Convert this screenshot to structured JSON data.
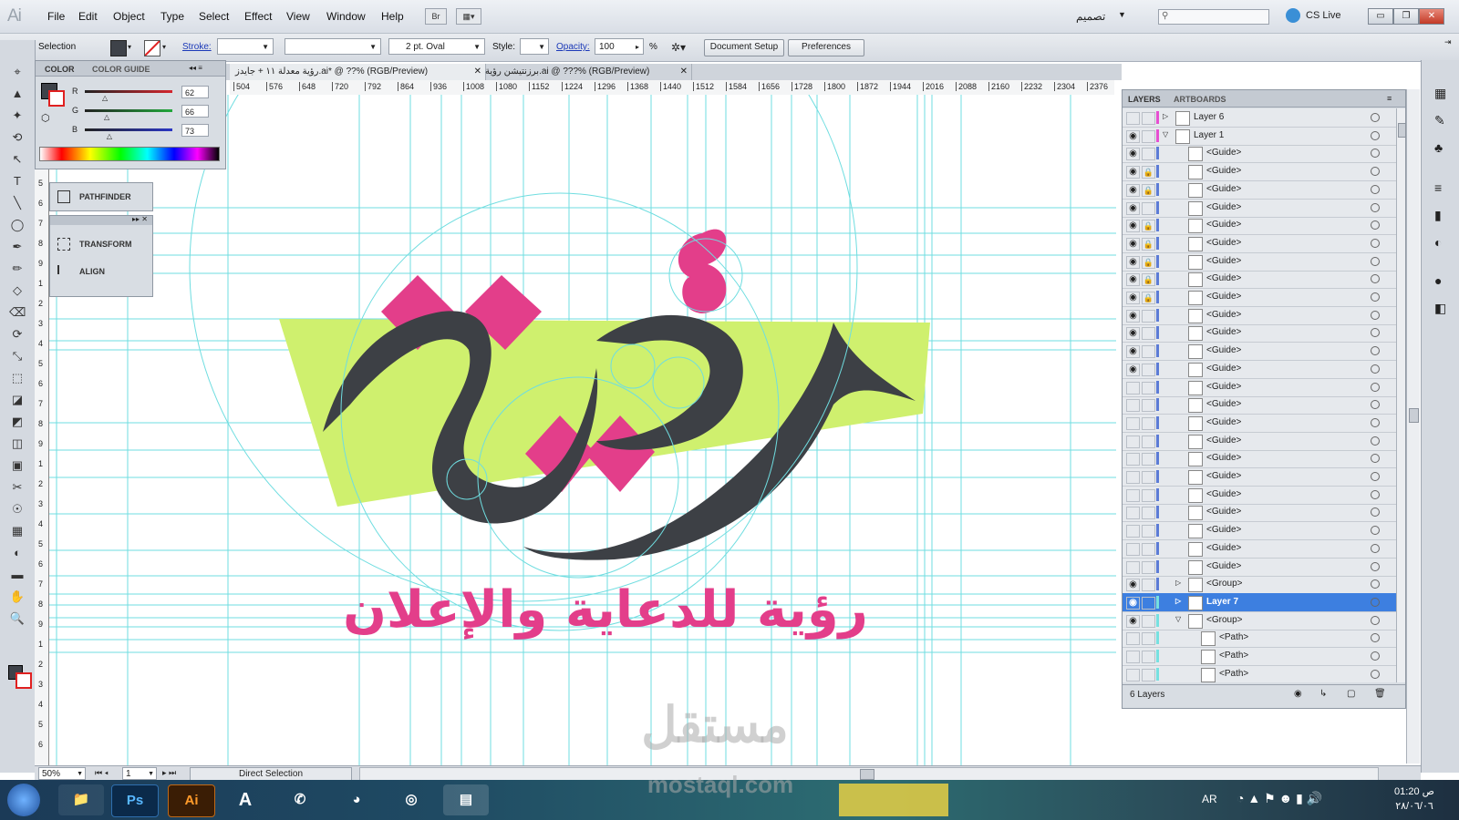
{
  "app": {
    "logo": "Ai"
  },
  "menu": [
    "File",
    "Edit",
    "Object",
    "Type",
    "Select",
    "Effect",
    "View",
    "Window",
    "Help"
  ],
  "menubar_right": {
    "bridge": "Br",
    "workspace": "تصميم",
    "cs_live": "CS Live"
  },
  "control": {
    "selection": "Selection",
    "stroke_label": "Stroke:",
    "brush": "2 pt. Oval",
    "style_label": "Style:",
    "opacity_label": "Opacity:",
    "opacity_value": "100",
    "opacity_unit": "%",
    "document_setup": "Document Setup",
    "preferences": "Preferences"
  },
  "tabs": [
    {
      "label": "رؤية معدلة ١١ + جايدز.ai* @ ??% (RGB/Preview)",
      "active": true
    },
    {
      "label": "برزنتيشن رؤية.ai @ ???% (RGB/Preview)",
      "active": false
    }
  ],
  "ruler_ticks": [
    "504",
    "576",
    "648",
    "720",
    "792",
    "864",
    "936",
    "1008",
    "1080",
    "1152",
    "1224",
    "1296",
    "1368",
    "1440",
    "1512",
    "1584",
    "1656",
    "1728",
    "1800",
    "1872",
    "1944",
    "2016",
    "2088",
    "2160",
    "2232",
    "2304",
    "2376"
  ],
  "vruler_ticks": [
    "1",
    "2",
    "3",
    "4",
    "5",
    "6",
    "7",
    "8",
    "9",
    "1",
    "2",
    "3",
    "4",
    "5",
    "6",
    "7",
    "8",
    "9",
    "1",
    "2",
    "3",
    "4",
    "5",
    "6",
    "7",
    "8",
    "9",
    "1",
    "2",
    "3",
    "4",
    "5",
    "6"
  ],
  "color_panel": {
    "tab_color": "COLOR",
    "tab_guide": "COLOR GUIDE",
    "channels": [
      {
        "label": "R",
        "value": "62",
        "level": 0.24,
        "color": "#d4262e"
      },
      {
        "label": "G",
        "value": "66",
        "level": 0.26,
        "color": "#22a83c"
      },
      {
        "label": "B",
        "value": "73",
        "level": 0.29,
        "color": "#2b36c4"
      }
    ],
    "fill_color": "#3e4249"
  },
  "side_panels": {
    "pathfinder": "PATHFINDER",
    "transform": "TRANSFORM",
    "align": "ALIGN"
  },
  "layers_panel": {
    "tab_layers": "LAYERS",
    "tab_artboards": "ARTBOARDS",
    "count": "6 Layers",
    "rows": [
      {
        "name": "Layer 6",
        "indent": 0,
        "eye": false,
        "lock": false,
        "expand": "right",
        "bar": "#e64fd1",
        "selected": false
      },
      {
        "name": "Layer 1",
        "indent": 0,
        "eye": true,
        "lock": false,
        "expand": "down",
        "bar": "#e64fd1",
        "selected": false
      },
      {
        "name": "<Guide>",
        "indent": 1,
        "eye": true,
        "lock": false,
        "bar": "#5b7bd6"
      },
      {
        "name": "<Guide>",
        "indent": 1,
        "eye": true,
        "lock": true,
        "bar": "#5b7bd6"
      },
      {
        "name": "<Guide>",
        "indent": 1,
        "eye": true,
        "lock": true,
        "bar": "#5b7bd6"
      },
      {
        "name": "<Guide>",
        "indent": 1,
        "eye": true,
        "lock": false,
        "bar": "#5b7bd6"
      },
      {
        "name": "<Guide>",
        "indent": 1,
        "eye": true,
        "lock": true,
        "bar": "#5b7bd6"
      },
      {
        "name": "<Guide>",
        "indent": 1,
        "eye": true,
        "lock": true,
        "bar": "#5b7bd6"
      },
      {
        "name": "<Guide>",
        "indent": 1,
        "eye": true,
        "lock": true,
        "bar": "#5b7bd6"
      },
      {
        "name": "<Guide>",
        "indent": 1,
        "eye": true,
        "lock": true,
        "bar": "#5b7bd6"
      },
      {
        "name": "<Guide>",
        "indent": 1,
        "eye": true,
        "lock": true,
        "bar": "#5b7bd6"
      },
      {
        "name": "<Guide>",
        "indent": 1,
        "eye": true,
        "lock": false,
        "bar": "#5b7bd6"
      },
      {
        "name": "<Guide>",
        "indent": 1,
        "eye": true,
        "lock": false,
        "bar": "#5b7bd6"
      },
      {
        "name": "<Guide>",
        "indent": 1,
        "eye": true,
        "lock": false,
        "bar": "#5b7bd6"
      },
      {
        "name": "<Guide>",
        "indent": 1,
        "eye": true,
        "lock": false,
        "bar": "#5b7bd6"
      },
      {
        "name": "<Guide>",
        "indent": 1,
        "eye": false,
        "lock": false,
        "bar": "#5b7bd6"
      },
      {
        "name": "<Guide>",
        "indent": 1,
        "eye": false,
        "lock": false,
        "bar": "#5b7bd6"
      },
      {
        "name": "<Guide>",
        "indent": 1,
        "eye": false,
        "lock": false,
        "bar": "#5b7bd6"
      },
      {
        "name": "<Guide>",
        "indent": 1,
        "eye": false,
        "lock": false,
        "bar": "#5b7bd6"
      },
      {
        "name": "<Guide>",
        "indent": 1,
        "eye": false,
        "lock": false,
        "bar": "#5b7bd6"
      },
      {
        "name": "<Guide>",
        "indent": 1,
        "eye": false,
        "lock": false,
        "bar": "#5b7bd6"
      },
      {
        "name": "<Guide>",
        "indent": 1,
        "eye": false,
        "lock": false,
        "bar": "#5b7bd6"
      },
      {
        "name": "<Guide>",
        "indent": 1,
        "eye": false,
        "lock": false,
        "bar": "#5b7bd6"
      },
      {
        "name": "<Guide>",
        "indent": 1,
        "eye": false,
        "lock": false,
        "bar": "#5b7bd6"
      },
      {
        "name": "<Guide>",
        "indent": 1,
        "eye": false,
        "lock": false,
        "bar": "#5b7bd6"
      },
      {
        "name": "<Guide>",
        "indent": 1,
        "eye": false,
        "lock": false,
        "bar": "#5b7bd6"
      },
      {
        "name": "<Group>",
        "indent": 1,
        "eye": true,
        "lock": false,
        "expand": "right",
        "bar": "#5b7bd6"
      },
      {
        "name": "Layer 7",
        "indent": 1,
        "eye": true,
        "lock": false,
        "expand": "right",
        "bar": "#76e0e0",
        "selected": true
      },
      {
        "name": "<Group>",
        "indent": 1,
        "eye": true,
        "lock": false,
        "expand": "down",
        "bar": "#76e0e0"
      },
      {
        "name": "<Path>",
        "indent": 2,
        "eye": false,
        "lock": false,
        "bar": "#76e0e0"
      },
      {
        "name": "<Path>",
        "indent": 2,
        "eye": false,
        "lock": false,
        "bar": "#76e0e0"
      },
      {
        "name": "<Path>",
        "indent": 2,
        "eye": false,
        "lock": false,
        "bar": "#76e0e0"
      }
    ]
  },
  "artwork": {
    "logo_word": "رؤية",
    "tagline": "رؤية للدعاية والإعلان",
    "colors": {
      "pink": "#e33e8a",
      "lime": "#cff06e",
      "dark": "#3d4045",
      "guide": "#6fdde0"
    }
  },
  "status": {
    "zoom": "50%",
    "page": "1",
    "tool": "Direct Selection"
  },
  "taskbar": {
    "apps": [
      "Ps",
      "Ai",
      "A"
    ],
    "lang": "AR",
    "time": "01:20 ص",
    "date": "٢٨/٠٦/٠٦"
  },
  "watermark": {
    "arabic": "مستقل",
    "latin": "mostaql.com"
  }
}
